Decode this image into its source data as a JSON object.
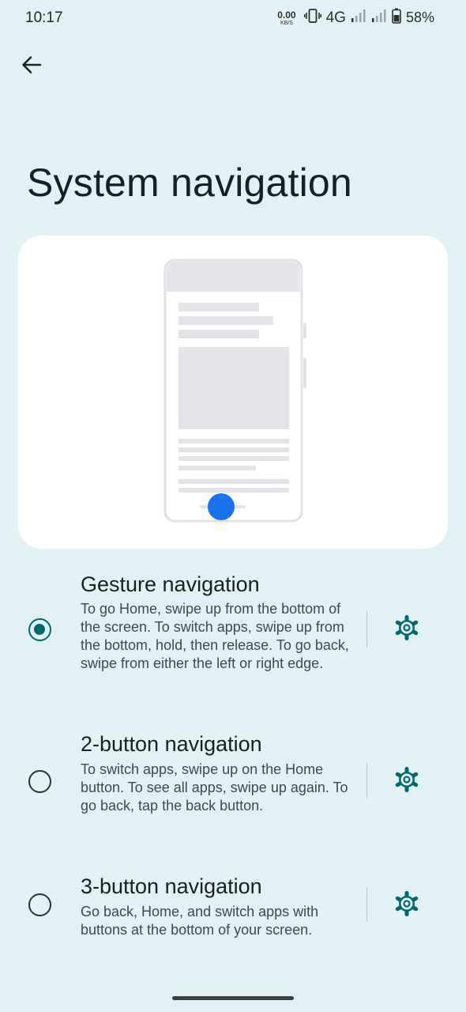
{
  "status_bar": {
    "time": "10:17",
    "net_speed_value": "0.00",
    "net_speed_unit": "KB/S",
    "network_type": "4G",
    "battery_percent": "58%",
    "icons": [
      "vibrate-icon",
      "signal-icon",
      "signal-icon",
      "battery-icon"
    ]
  },
  "header": {
    "back_icon": "arrow-back-icon",
    "title": "System navigation"
  },
  "options": [
    {
      "title": "Gesture navigation",
      "description": "To go Home, swipe up from the bottom of the screen. To switch apps, swipe up from the bottom, hold, then release. To go back, swipe from either the left or right edge.",
      "selected": true,
      "settings_icon": "gear-icon"
    },
    {
      "title": "2-button navigation",
      "description": "To switch apps, swipe up on the Home button. To see all apps, swipe up again. To go back, tap the back button.",
      "selected": false,
      "settings_icon": "gear-icon"
    },
    {
      "title": "3-button navigation",
      "description": "Go back, Home, and switch apps with buttons at the bottom of your screen.",
      "selected": false,
      "settings_icon": "gear-icon"
    }
  ],
  "colors": {
    "background": "#e2f1f4",
    "accent": "#00696e",
    "illustration_dot": "#1a73e8"
  }
}
